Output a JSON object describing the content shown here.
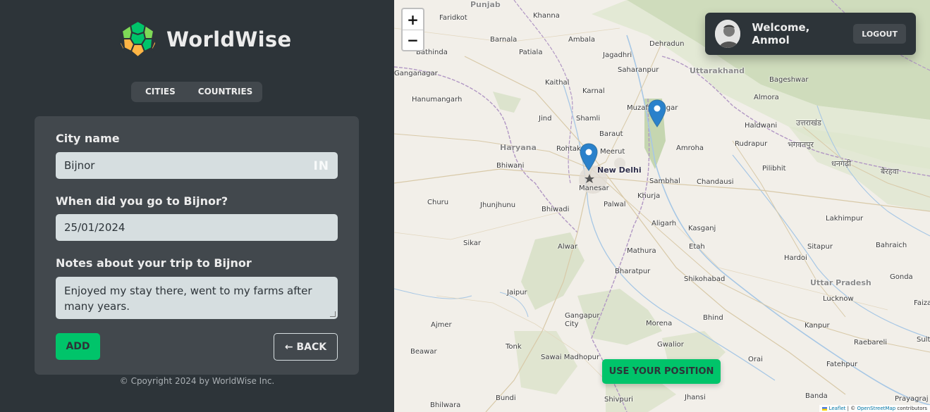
{
  "app": {
    "name": "WorldWise",
    "colors": {
      "brand": "#00c46a",
      "dark0": "#2d3439",
      "dark1": "#42484d",
      "light": "#d6dee0",
      "accent_orange": "#ffb545"
    }
  },
  "tabs": [
    {
      "label": "CITIES"
    },
    {
      "label": "COUNTRIES"
    }
  ],
  "form": {
    "city_label": "City name",
    "city_value": "Bijnor",
    "city_flag": "IN",
    "date_label": "When did you go to Bijnor?",
    "date_value": "25/01/2024",
    "notes_label": "Notes about your trip to Bijnor",
    "notes_value": "Enjoyed my stay there, went to my farms after many years.",
    "add_label": "ADD",
    "back_label": "← BACK"
  },
  "footer": {
    "copyright": "© Cpoyright 2024 by WorldWise Inc."
  },
  "map": {
    "zoom_in": "+",
    "zoom_out": "−",
    "use_position": "USE YOUR POSITION",
    "attribution": {
      "leaflet": "Leaflet",
      "sep": " | © ",
      "osm": "OpenStreetMap",
      "suffix": " contributors"
    },
    "places": [
      "Punjab",
      "Faridkot",
      "Khanna",
      "Barnala",
      "Ambala",
      "Dehradun",
      "Bathinda",
      "Patiala",
      "Jagadhri",
      "Saharanpur",
      "Uttarakhand",
      "Bageshwar",
      "Ganganagar",
      "Kaithal",
      "Karnal",
      "Almora",
      "Hanumangarh",
      "Muzaffarnagar",
      "Jind",
      "Shamli",
      "Haldwani",
      "Baraut",
      "Rudrapur",
      "Haryana",
      "Rohtak",
      "Meerut",
      "Amroha",
      "Bhiwani",
      "New Delhi",
      "Pilibhit",
      "Sambhal",
      "Chandausi",
      "Manesar",
      "Khurja",
      "Churu",
      "Jhunjhunu",
      "Bhiwadi",
      "Palwal",
      "Lakhimpur",
      "Aligarh",
      "Kasganj",
      "Sikar",
      "Alwar",
      "Etah",
      "Sitapur",
      "Bahraich",
      "Mathura",
      "Hardoi",
      "Bharatpur",
      "Shikohabad",
      "Uttar Pradesh",
      "Gonda",
      "Jaipur",
      "Lucknow",
      "Faizabad",
      "Gangapur City",
      "Bhind",
      "Ajmer",
      "Morena",
      "Kanpur",
      "Tonk",
      "Gwalior",
      "Raebareli",
      "Sultanpur",
      "Beawar",
      "Sawai Madhopur",
      "Orai",
      "Fatehpur",
      "Bundi",
      "Shivpuri",
      "Jhansi",
      "Banda",
      "Prayagraj",
      "Bhilwara"
    ],
    "hindi_places": [
      "उत्तराखंड",
      "भगवतपुर",
      "धनगढ़ी",
      "बैरहवा"
    ]
  },
  "user": {
    "welcome": "Welcome, Anmol",
    "logout": "LOGOUT"
  },
  "markers": [
    {
      "name": "Bijnor"
    },
    {
      "name": "Delhi"
    }
  ]
}
